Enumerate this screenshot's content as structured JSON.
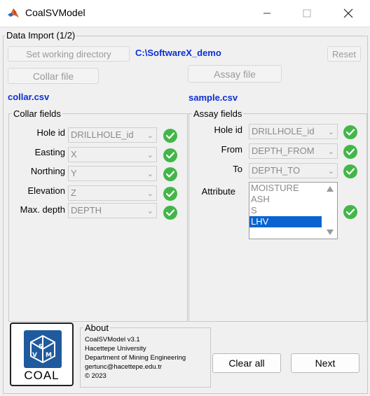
{
  "window": {
    "title": "CoalSVModel"
  },
  "import_panel": {
    "title": "Data Import (1/2)",
    "set_dir_label": "Set working directory",
    "working_dir": "C:\\SoftwareX_demo",
    "reset_label": "Reset",
    "collar_file_label": "Collar file",
    "collar_file_name": "collar.csv",
    "assay_file_label": "Assay file",
    "assay_file_name": "sample.csv"
  },
  "collar_fields": {
    "title": "Collar fields",
    "rows": [
      {
        "label": "Hole id",
        "value": "DRILLHOLE_id"
      },
      {
        "label": "Easting",
        "value": "X"
      },
      {
        "label": "Northing",
        "value": "Y"
      },
      {
        "label": "Elevation",
        "value": "Z"
      },
      {
        "label": "Max. depth",
        "value": "DEPTH"
      }
    ]
  },
  "assay_fields": {
    "title": "Assay fields",
    "rows": [
      {
        "label": "Hole id",
        "value": "DRILLHOLE_id"
      },
      {
        "label": "From",
        "value": "DEPTH_FROM"
      },
      {
        "label": "To",
        "value": "DEPTH_TO"
      }
    ],
    "attribute_label": "Attribute",
    "attribute_options": [
      "MOISTURE",
      "ASH",
      "S",
      "LHV"
    ],
    "attribute_selected": "LHV"
  },
  "logo": {
    "text": "COAL",
    "mark": "SVM"
  },
  "about": {
    "title": "About",
    "lines": [
      "CoalSVModel v3.1",
      "Hacettepe University",
      "Department of Mining Engineering",
      "gertunc@hacettepe.edu.tr",
      "© 2023"
    ]
  },
  "actions": {
    "clear_label": "Clear all",
    "next_label": "Next"
  },
  "colors": {
    "check_green": "#43b649",
    "link_blue": "#0a2fd6",
    "selection_blue": "#0a63d1"
  }
}
